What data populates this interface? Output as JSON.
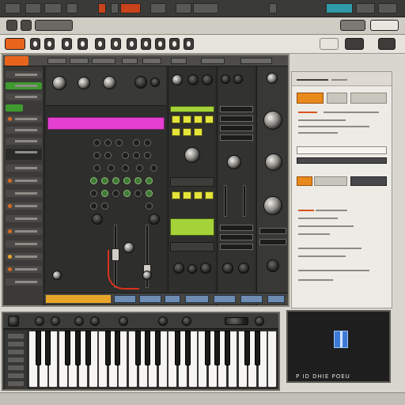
{
  "preview": {
    "title": "P ID DHIE POEU",
    "icon": "window-logo-icon"
  },
  "colors": {
    "accent_orange": "#e8641d",
    "accent_red": "#c8421b",
    "lcd_green": "#a6d239",
    "pink": "#e33fd0",
    "teal": "#2f9aa8"
  }
}
